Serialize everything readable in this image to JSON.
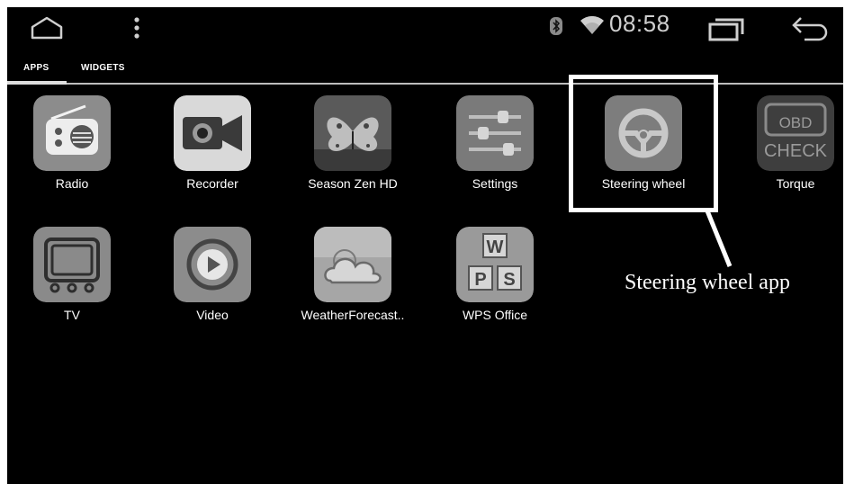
{
  "status_bar": {
    "home_icon": "home-outline-icon",
    "menu_icon": "vertical-dots-icon",
    "bluetooth_icon": "bluetooth-icon",
    "wifi_icon": "wifi-icon",
    "time": "08:58",
    "recents_icon": "recent-apps-icon",
    "back_icon": "back-arrow-icon"
  },
  "tabs": [
    {
      "label": "APPS",
      "selected": true
    },
    {
      "label": "WIDGETS",
      "selected": false
    }
  ],
  "apps": [
    {
      "label": "Radio",
      "icon": "radio-icon"
    },
    {
      "label": "Recorder",
      "icon": "video-camera-icon"
    },
    {
      "label": "Season Zen HD",
      "icon": "butterfly-photo-icon"
    },
    {
      "label": "Settings",
      "icon": "sliders-icon"
    },
    {
      "label": "Steering wheel",
      "icon": "steering-wheel-icon"
    },
    {
      "label": "Torque",
      "icon": "obd-check-icon",
      "icon_text": [
        "OBD",
        "CHECK"
      ]
    },
    {
      "label": "TV",
      "icon": "tv-icon"
    },
    {
      "label": "Video",
      "icon": "play-icon"
    },
    {
      "label": "WeatherForecast..",
      "icon": "cloud-sun-icon"
    },
    {
      "label": "WPS Office",
      "icon": "wps-icon",
      "icon_text": [
        "W",
        "P",
        "S"
      ]
    }
  ],
  "annotation": {
    "text": "Steering wheel app",
    "highlighted_app": "Steering wheel"
  },
  "colors": {
    "screen_bg": "#000000",
    "annotation": "#ffffff"
  }
}
